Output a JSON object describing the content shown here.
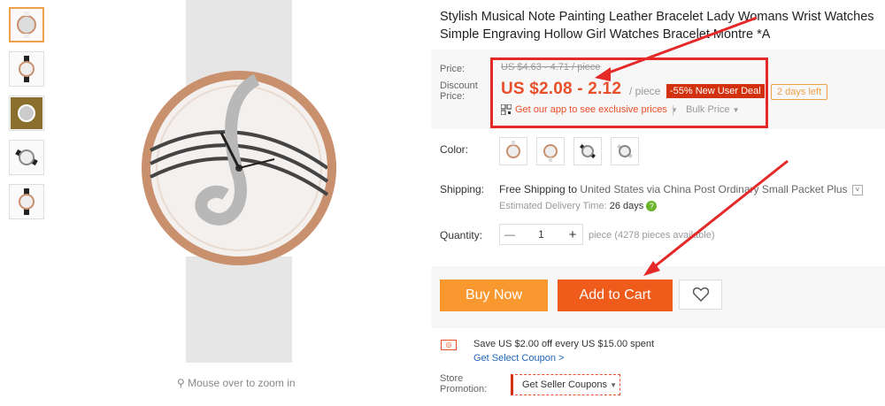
{
  "product": {
    "title": "Stylish Musical Note Painting Leather Bracelet Lady Womans Wrist Watches Simple Engraving Hollow Girl Watches Bracelet Montre *A",
    "thumbnails": [
      "thumb-1",
      "thumb-2",
      "thumb-3",
      "thumb-4",
      "thumb-5"
    ],
    "zoom_hint": "Mouse over to zoom in"
  },
  "price": {
    "label_price": "Price:",
    "label_discount_1": "Discount",
    "label_discount_2": "Price:",
    "original": "US $4.63 - 4.71 / piece",
    "current": "US $2.08 - 2.12",
    "unit": "/ piece",
    "deal_badge": "-55% New User Deal",
    "days_left": "2 days left",
    "app_promo": "Get our app to see exclusive prices",
    "bulk_price": "Bulk Price"
  },
  "options": {
    "color_label": "Color:",
    "shipping_label": "Shipping:",
    "shipping_free": "Free Shipping to",
    "shipping_detail": "United States via China Post Ordinary Small Packet Plus",
    "delivery_label": "Estimated Delivery Time:",
    "delivery_value": "26 days",
    "quantity_label": "Quantity:",
    "quantity_value": "1",
    "quantity_note": "piece (4278 pieces available)"
  },
  "actions": {
    "buy_now": "Buy Now",
    "add_to_cart": "Add to Cart"
  },
  "coupon": {
    "save_text": "Save US $2.00 off every US $15.00 spent",
    "get_coupon": "Get Select Coupon >",
    "store_label_1": "Store",
    "store_label_2": "Promotion:",
    "seller_coupons": "Get Seller Coupons"
  },
  "colors": {
    "accent": "#e94f2a",
    "buy": "#f8982f",
    "cart": "#ee5b1b",
    "highlight": "#e52828"
  }
}
